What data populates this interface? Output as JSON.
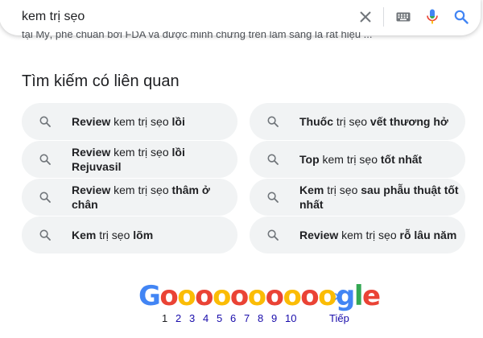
{
  "search": {
    "query": "kem trị sẹo"
  },
  "snippet": {
    "text": "tại Mỹ, phê chuẩn bởi FDA và được minh chứng trên lâm sàng là rất hiệu ..."
  },
  "related": {
    "heading": "Tìm kiếm có liên quan",
    "items": [
      {
        "parts": [
          {
            "b": true,
            "t": "Review"
          },
          {
            "b": false,
            "t": " kem trị sẹo "
          },
          {
            "b": true,
            "t": "lồi"
          }
        ]
      },
      {
        "parts": [
          {
            "b": true,
            "t": "Thuốc"
          },
          {
            "b": false,
            "t": " trị sẹo "
          },
          {
            "b": true,
            "t": "vết thương hở"
          }
        ]
      },
      {
        "parts": [
          {
            "b": true,
            "t": "Review"
          },
          {
            "b": false,
            "t": " kem trị sẹo "
          },
          {
            "b": true,
            "t": "lồi Rejuvasil"
          }
        ]
      },
      {
        "parts": [
          {
            "b": true,
            "t": "Top"
          },
          {
            "b": false,
            "t": " kem trị sẹo "
          },
          {
            "b": true,
            "t": "tốt nhất"
          }
        ]
      },
      {
        "parts": [
          {
            "b": true,
            "t": "Review"
          },
          {
            "b": false,
            "t": " kem trị sẹo "
          },
          {
            "b": true,
            "t": "thâm ở chân"
          }
        ]
      },
      {
        "parts": [
          {
            "b": true,
            "t": "Kem"
          },
          {
            "b": false,
            "t": " trị sẹo "
          },
          {
            "b": true,
            "t": "sau phẫu thuật tốt nhất"
          }
        ]
      },
      {
        "parts": [
          {
            "b": true,
            "t": "Kem"
          },
          {
            "b": false,
            "t": " trị sẹo "
          },
          {
            "b": true,
            "t": "lõm"
          }
        ]
      },
      {
        "parts": [
          {
            "b": true,
            "t": "Review"
          },
          {
            "b": false,
            "t": " kem trị sẹo "
          },
          {
            "b": true,
            "t": "rỗ lâu năm"
          }
        ]
      }
    ]
  },
  "pagination": {
    "logo": "Goooooooooogle",
    "pages": [
      "1",
      "2",
      "3",
      "4",
      "5",
      "6",
      "7",
      "8",
      "9",
      "10"
    ],
    "current": "1",
    "next_label": "Tiếp",
    "next_icon": "chevron-right-icon"
  },
  "icons": {
    "clear": "close-icon",
    "keyboard": "keyboard-icon",
    "voice": "microphone-icon",
    "search": "search-icon",
    "chip": "search-icon"
  },
  "colors": {
    "link": "#1a0dab",
    "chip_bg": "#f1f3f4",
    "google_blue": "#4285f4",
    "google_red": "#ea4335",
    "google_yellow": "#fbbc05",
    "google_green": "#34a853"
  }
}
